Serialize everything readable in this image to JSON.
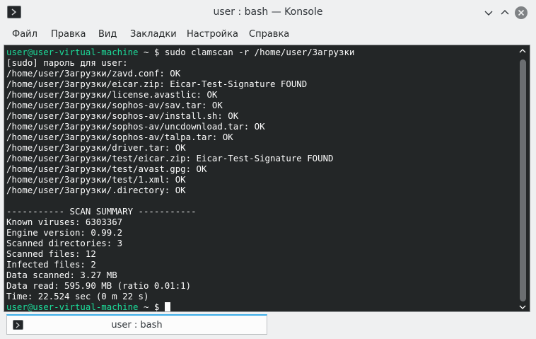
{
  "window": {
    "title": "user : bash — Konsole"
  },
  "menu": {
    "items": [
      "Файл",
      "Правка",
      "Вид",
      "Закладки",
      "Настройка",
      "Справка"
    ]
  },
  "terminal": {
    "prompt_user": "user@user-virtual-machine",
    "prompt_path": " ~ $ ",
    "command": "sudo clamscan -r /home/user/Загрузки",
    "output_lines": [
      "[sudo] пароль для user:",
      "/home/user/Загрузки/zavd.conf: OK",
      "/home/user/Загрузки/eicar.zip: Eicar-Test-Signature FOUND",
      "/home/user/Загрузки/license.avastlic: OK",
      "/home/user/Загрузки/sophos-av/sav.tar: OK",
      "/home/user/Загрузки/sophos-av/install.sh: OK",
      "/home/user/Загрузки/sophos-av/uncdownload.tar: OK",
      "/home/user/Загрузки/sophos-av/talpa.tar: OK",
      "/home/user/Загрузки/driver.tar: OK",
      "/home/user/Загрузки/test/eicar.zip: Eicar-Test-Signature FOUND",
      "/home/user/Загрузки/test/avast.gpg: OK",
      "/home/user/Загрузки/test/1.xml: OK",
      "/home/user/Загрузки/.directory: OK",
      "",
      "----------- SCAN SUMMARY -----------",
      "Known viruses: 6303367",
      "Engine version: 0.99.2",
      "Scanned directories: 3",
      "Scanned files: 12",
      "Infected files: 2",
      "Data scanned: 3.27 MB",
      "Data read: 595.90 MB (ratio 0.01:1)",
      "Time: 22.524 sec (0 m 22 s)"
    ],
    "final_prompt_user": "user@user-virtual-machine",
    "final_prompt_path": " ~ $ "
  },
  "tabs": [
    {
      "label": "user : bash"
    }
  ],
  "colors": {
    "terminal_bg": "#232627",
    "terminal_fg": "#fcfcfc",
    "prompt_user": "#1cdc9a",
    "accent": "#3daee9"
  }
}
